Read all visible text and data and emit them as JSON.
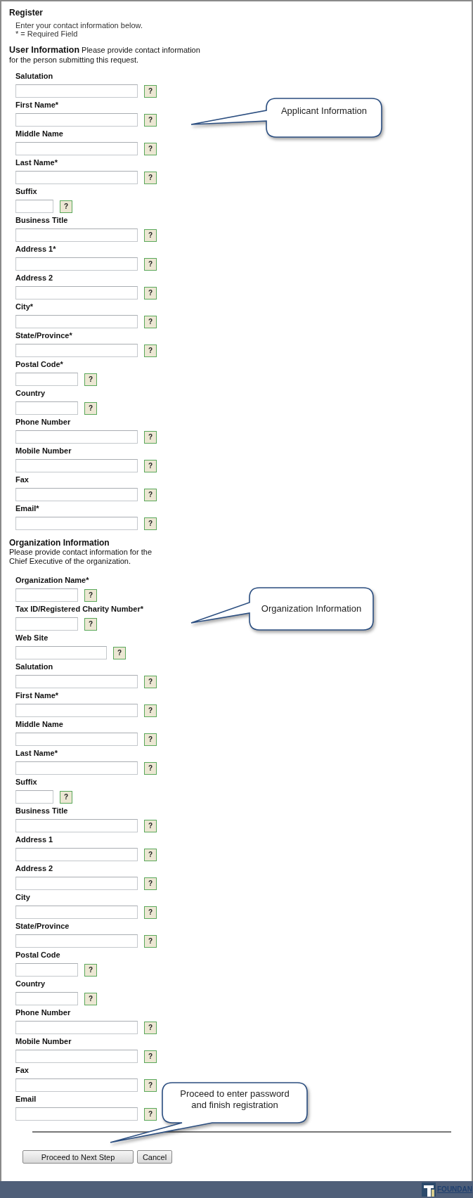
{
  "title": "Register",
  "intro": [
    "Enter your contact information below.",
    "* = Required Field"
  ],
  "sections": [
    {
      "kind": "inline",
      "heading": "User Information",
      "description": "Please provide contact information for the person submitting this request.",
      "fields": [
        {
          "label": "Salutation",
          "kind": "long",
          "help": "?"
        },
        {
          "label": "First Name*",
          "kind": "long",
          "help": "?",
          "callout": {
            "kind": "left",
            "text": "Applicant Information"
          }
        },
        {
          "label": "Middle Name",
          "kind": "long",
          "help": "?"
        },
        {
          "label": "Last Name*",
          "kind": "long",
          "help": "?"
        },
        {
          "label": "Suffix",
          "kind": "tiny",
          "help": "?"
        },
        {
          "label": "Business Title",
          "kind": "long",
          "help": "?"
        },
        {
          "label": "Address 1*",
          "kind": "long",
          "help": "?"
        },
        {
          "label": "Address 2",
          "kind": "long",
          "help": "?"
        },
        {
          "label": "City*",
          "kind": "long",
          "help": "?"
        },
        {
          "label": "State/Province*",
          "kind": "long",
          "help": "?"
        },
        {
          "label": "Postal Code*",
          "kind": "short",
          "help": "?"
        },
        {
          "label": "Country",
          "kind": "short",
          "help": "?"
        },
        {
          "label": "Phone Number",
          "kind": "long",
          "help": "?"
        },
        {
          "label": "Mobile Number",
          "kind": "long",
          "help": "?"
        },
        {
          "label": "Fax",
          "kind": "long",
          "help": "?"
        },
        {
          "label": "Email*",
          "kind": "long",
          "help": "?"
        }
      ]
    },
    {
      "kind": "stacked",
      "heading": "Organization Information",
      "description": "Please provide contact information for the Chief Executive of the organization.",
      "fields": [
        {
          "label": "Organization Name*",
          "kind": "short",
          "help": "?"
        },
        {
          "label": "Tax ID/Registered Charity Number*",
          "kind": "short",
          "help": "?",
          "callout": {
            "kind": "left",
            "text": "Organization Information"
          }
        },
        {
          "label": "Web Site",
          "kind": "medium",
          "help": "?"
        },
        {
          "label": "Salutation",
          "kind": "long",
          "help": "?"
        },
        {
          "label": "First Name*",
          "kind": "long",
          "help": "?"
        },
        {
          "label": "Middle Name",
          "kind": "long",
          "help": "?"
        },
        {
          "label": "Last Name*",
          "kind": "long",
          "help": "?"
        },
        {
          "label": "Suffix",
          "kind": "tiny",
          "help": "?"
        },
        {
          "label": "Business Title",
          "kind": "long",
          "help": "?"
        },
        {
          "label": "Address 1",
          "kind": "long",
          "help": "?"
        },
        {
          "label": "Address 2",
          "kind": "long",
          "help": "?"
        },
        {
          "label": "City",
          "kind": "long",
          "help": "?"
        },
        {
          "label": "State/Province",
          "kind": "long",
          "help": "?"
        },
        {
          "label": "Postal Code",
          "kind": "short",
          "help": "?"
        },
        {
          "label": "Country",
          "kind": "short",
          "help": "?"
        },
        {
          "label": "Phone Number",
          "kind": "long",
          "help": "?"
        },
        {
          "label": "Mobile Number",
          "kind": "long",
          "help": "?"
        },
        {
          "label": "Fax",
          "kind": "long",
          "help": "?"
        },
        {
          "label": "Email",
          "kind": "long",
          "help": "?"
        }
      ]
    }
  ],
  "actions": {
    "callout": {
      "kind": "bottom",
      "text": "Proceed to enter password and finish registration"
    },
    "buttons": [
      {
        "label": "Proceed to Next Step",
        "kind": "primary"
      },
      {
        "label": "Cancel",
        "kind": "secondary"
      }
    ]
  },
  "footer": {
    "logo_text": "FOUNDAN"
  }
}
